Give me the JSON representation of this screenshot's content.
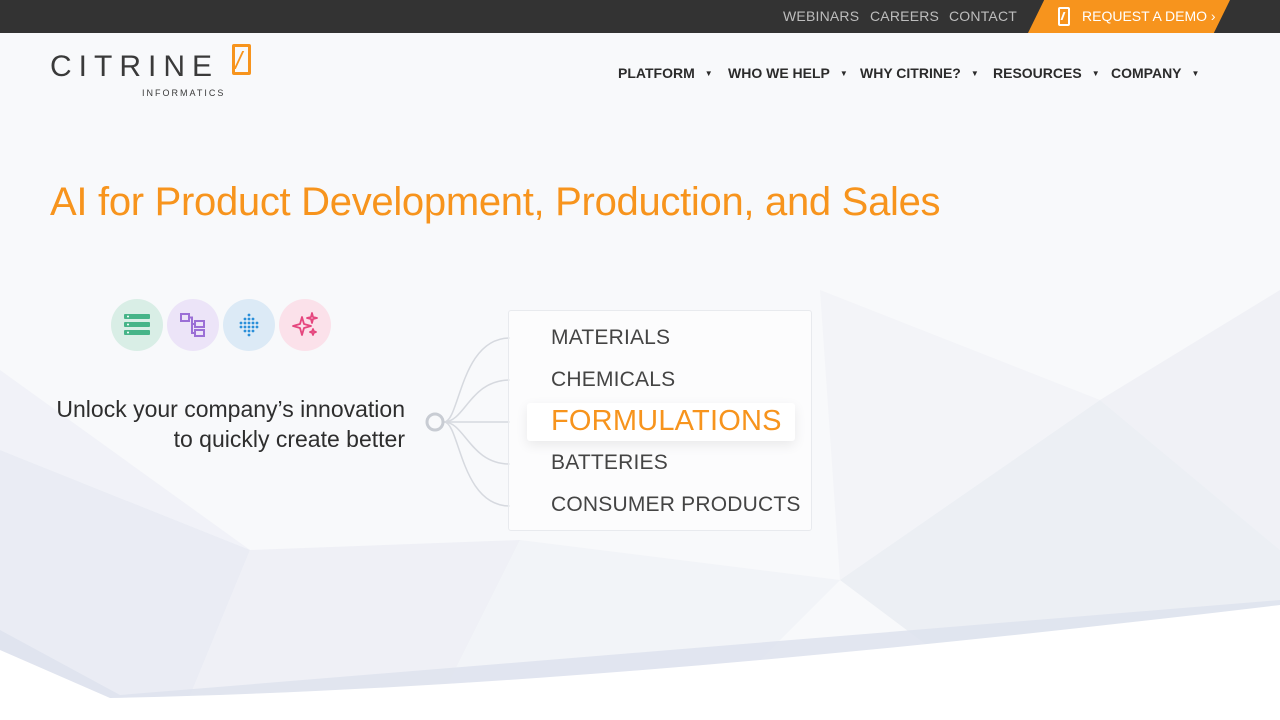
{
  "topbar": {
    "links": [
      "WEBINARS",
      "CAREERS",
      "CONTACT"
    ],
    "demo_label": "REQUEST A DEMO ›"
  },
  "logo": {
    "wordmark": "CITRINE",
    "subtitle": "INFORMATICS"
  },
  "nav": {
    "items": [
      {
        "label": "PLATFORM"
      },
      {
        "label": "WHO WE HELP"
      },
      {
        "label": "WHY CITRINE?"
      },
      {
        "label": "RESOURCES"
      },
      {
        "label": "COMPANY"
      }
    ],
    "caret": "▼"
  },
  "hero": {
    "title": "AI for Product Development, Production, and Sales",
    "tagline_line1": "Unlock your company’s innovation",
    "tagline_line2": "to quickly create better",
    "feature_icons": [
      "database-icon",
      "workflow-icon",
      "dots-grid-icon",
      "sparkles-icon"
    ],
    "categories": [
      "MATERIALS",
      "CHEMICALS",
      "FORMULATIONS",
      "BATTERIES",
      "CONSUMER PRODUCTS"
    ],
    "active_category": "FORMULATIONS"
  },
  "colors": {
    "brand_orange": "#f7941d",
    "topbar_bg": "#333333",
    "text_dark": "#2b2b2b"
  }
}
